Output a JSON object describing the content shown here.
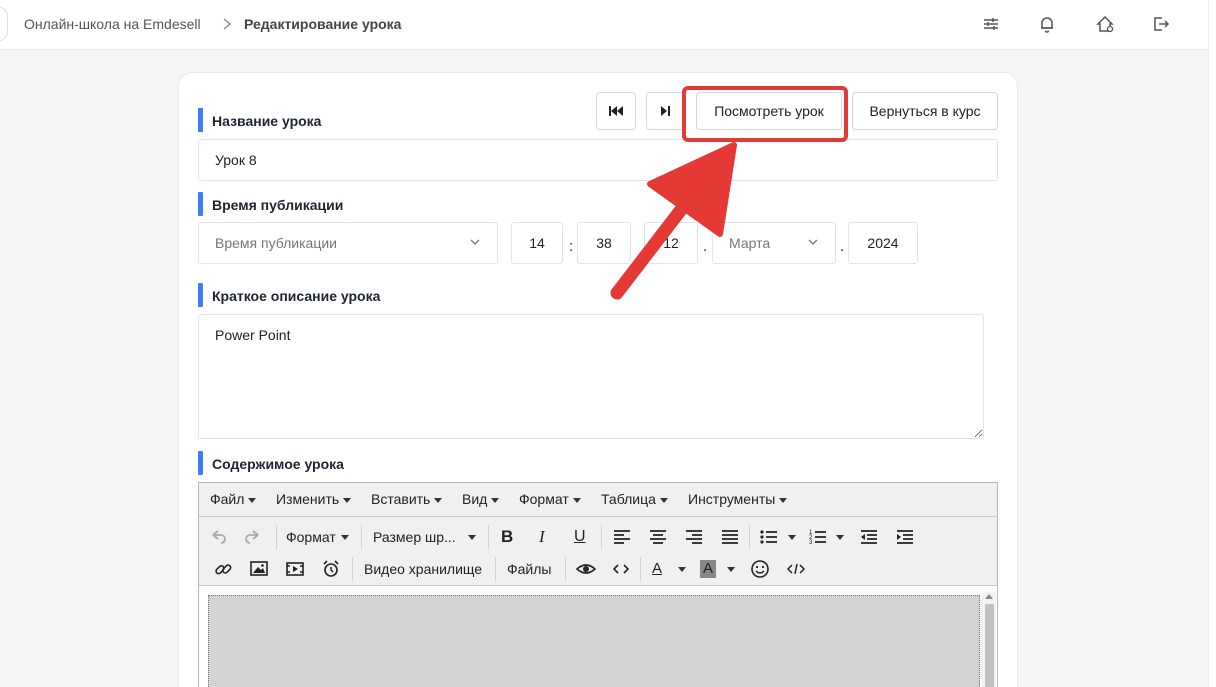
{
  "breadcrumb": {
    "home": "Онлайн-школа на Emdesell",
    "current": "Редактирование урока"
  },
  "header_icons": [
    "sliders-icon",
    "bell-icon",
    "home-gear-icon",
    "logout-icon"
  ],
  "nav": {
    "view_lesson": "Посмотреть урок",
    "back_to_course": "Вернуться в курс"
  },
  "lesson_name": {
    "label": "Название урока",
    "value": "Урок 8"
  },
  "publish_time": {
    "label": "Время публикации",
    "mode_placeholder": "Время публикации",
    "hour": "14",
    "minute": "38",
    "day": "12",
    "month": "Марта",
    "year": "2024"
  },
  "short_description": {
    "label": "Краткое описание урока",
    "value": "Power Point"
  },
  "content": {
    "label": "Содержимое урока",
    "menubar": [
      "Файл",
      "Изменить",
      "Вставить",
      "Вид",
      "Формат",
      "Таблица",
      "Инструменты"
    ],
    "toolbar": {
      "format": "Формат",
      "font_size": "Размер шр...",
      "bold": "B",
      "italic": "I",
      "underline": "U",
      "video_storage": "Видео хранилище",
      "files": "Файлы",
      "font_color": "A",
      "bg_color": "A"
    }
  },
  "colors": {
    "accent": "#3b7ef6",
    "highlight": "#e53935"
  }
}
